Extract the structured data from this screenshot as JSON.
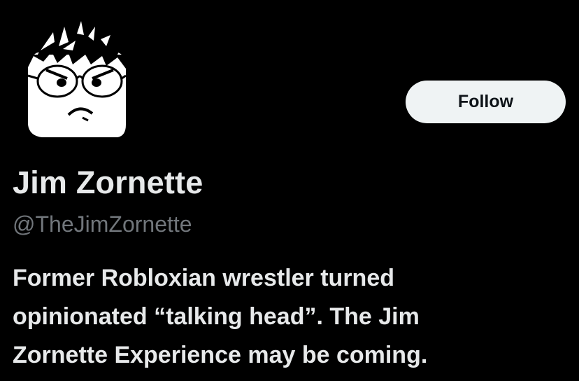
{
  "profile": {
    "display_name": "Jim Zornette",
    "handle": "@TheJimZornette",
    "follow_label": "Follow",
    "bio_lines": [
      "Former Robloxian wrestler turned",
      "opinionated “talking head”. The Jim",
      "Zornette Experience may be coming."
    ],
    "avatar_icon": "roblox-head-avatar-icon"
  },
  "colors": {
    "background": "#000000",
    "text_primary": "#e7e9ea",
    "text_secondary": "#71767b",
    "button_bg": "#eff3f4",
    "button_text": "#0f1419"
  }
}
